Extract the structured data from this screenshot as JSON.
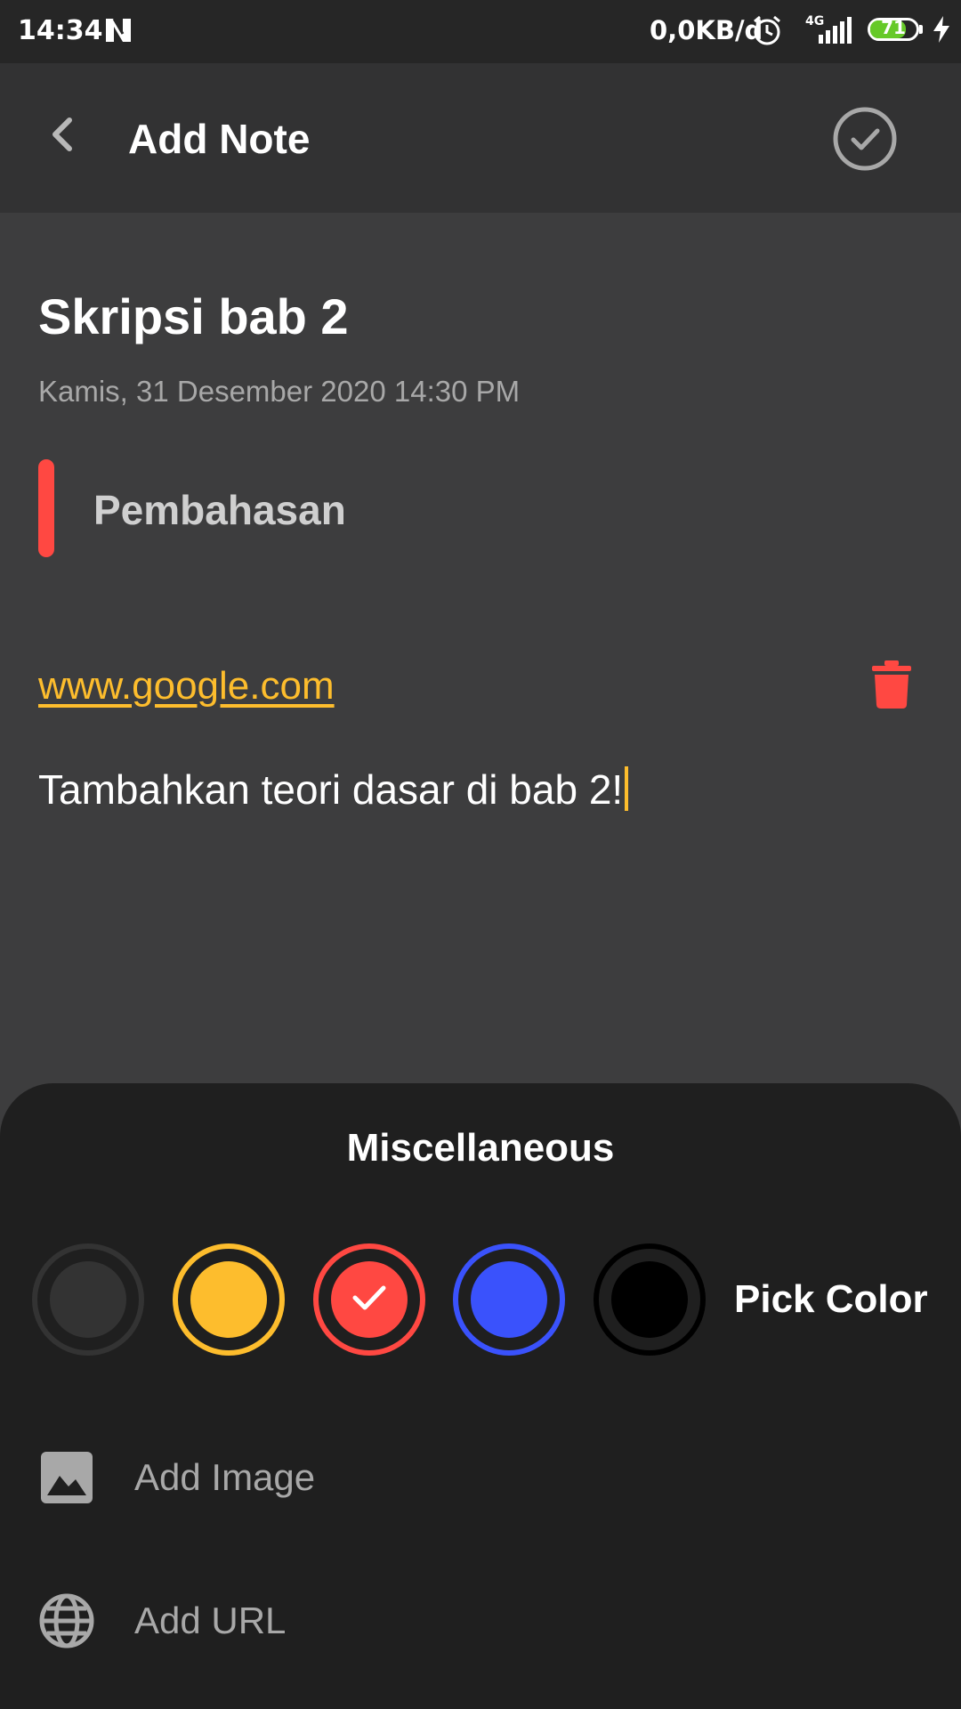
{
  "status_bar": {
    "time": "14:34",
    "network_speed": "0,0KB/d",
    "network_type": "4G",
    "battery_level": "71"
  },
  "app_bar": {
    "title": "Add Note",
    "back_icon": "chevron-left-icon",
    "done_icon": "check-circle-icon"
  },
  "note": {
    "title": "Skripsi bab 2",
    "date": "Kamis, 31 Desember 2020 14:30 PM",
    "subtitle": "Pembahasan",
    "subtitle_indicator_color": "#ff4842",
    "url": "www.google.com",
    "delete_url_icon": "trash-icon",
    "body": "Tambahkan teori dasar di bab 2!"
  },
  "sheet": {
    "title": "Miscellaneous",
    "colors": [
      {
        "color": "#333333",
        "selected": false
      },
      {
        "color": "#fdbd2d",
        "selected": false
      },
      {
        "color": "#ff4842",
        "selected": true
      },
      {
        "color": "#3a52fc",
        "selected": false
      },
      {
        "color": "#000000",
        "selected": false
      }
    ],
    "pick_color_label": "Pick Color",
    "add_image_label": "Add Image",
    "add_image_icon": "image-icon",
    "add_url_label": "Add URL",
    "add_url_icon": "globe-icon"
  }
}
